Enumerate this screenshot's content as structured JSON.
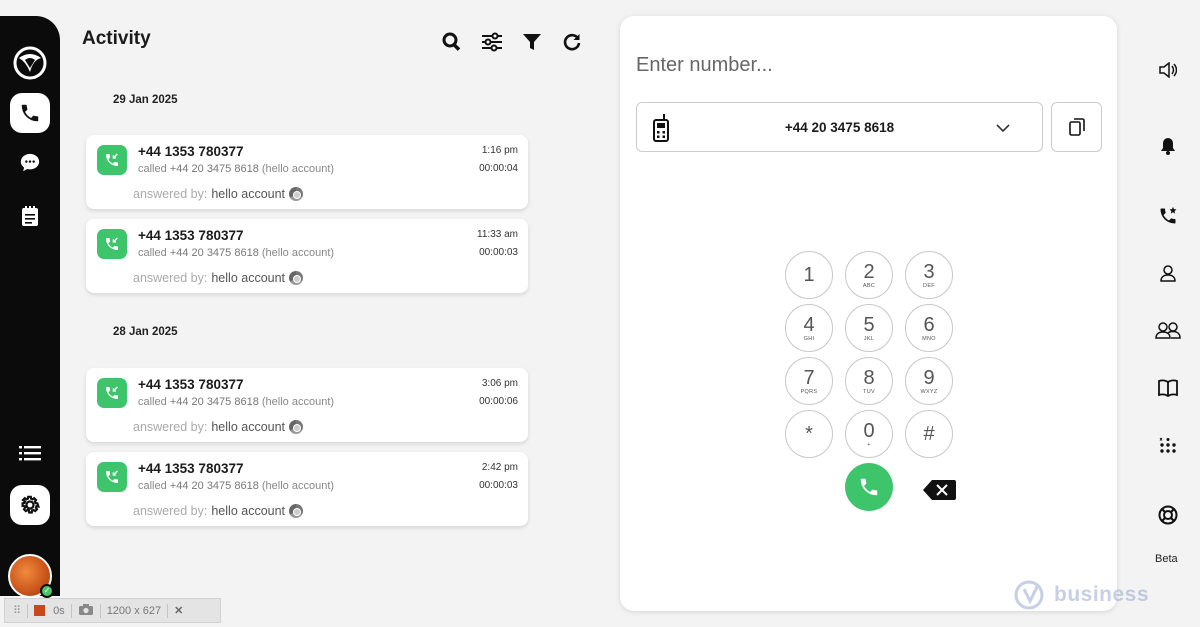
{
  "activity": {
    "title": "Activity",
    "groups": [
      {
        "date": "29 Jan 2025",
        "calls": [
          {
            "number": "+44 1353 780377",
            "called_prefix": "called",
            "called_number": "+44 20 3475 8618",
            "called_account": "(hello account)",
            "time": "1:16 pm",
            "duration": "00:00:04",
            "answered_label": "answered by:",
            "answered_by": "hello account"
          },
          {
            "number": "+44 1353 780377",
            "called_prefix": "called",
            "called_number": "+44 20 3475 8618",
            "called_account": "(hello account)",
            "time": "11:33 am",
            "duration": "00:00:03",
            "answered_label": "answered by:",
            "answered_by": "hello account"
          }
        ]
      },
      {
        "date": "28 Jan 2025",
        "calls": [
          {
            "number": "+44 1353 780377",
            "called_prefix": "called",
            "called_number": "+44 20 3475 8618",
            "called_account": "(hello account)",
            "time": "3:06 pm",
            "duration": "00:00:06",
            "answered_label": "answered by:",
            "answered_by": "hello account"
          },
          {
            "number": "+44 1353 780377",
            "called_prefix": "called",
            "called_number": "+44 20 3475 8618",
            "called_account": "(hello account)",
            "time": "2:42 pm",
            "duration": "00:00:03",
            "answered_label": "answered by:",
            "answered_by": "hello account"
          }
        ]
      }
    ]
  },
  "dialer": {
    "placeholder": "Enter number...",
    "caller_id": "+44 20 3475 8618",
    "keys": [
      {
        "digit": "1",
        "letters": ""
      },
      {
        "digit": "2",
        "letters": "ABC"
      },
      {
        "digit": "3",
        "letters": "DEF"
      },
      {
        "digit": "4",
        "letters": "GHI"
      },
      {
        "digit": "5",
        "letters": "JKL"
      },
      {
        "digit": "6",
        "letters": "MNO"
      },
      {
        "digit": "7",
        "letters": "PQRS"
      },
      {
        "digit": "8",
        "letters": "TUV"
      },
      {
        "digit": "9",
        "letters": "WXYZ"
      },
      {
        "digit": "*",
        "letters": ""
      },
      {
        "digit": "0",
        "letters": "+"
      },
      {
        "digit": "#",
        "letters": ""
      }
    ]
  },
  "right_rail": {
    "beta_label": "Beta"
  },
  "recorder": {
    "elapsed": "0s",
    "dimensions": "1200 x 627"
  },
  "watermark": {
    "text": "business"
  },
  "colors": {
    "call_green": "#3ec46b",
    "rail_bg": "#0b0b0b",
    "recorder_stop": "#c9481c"
  }
}
